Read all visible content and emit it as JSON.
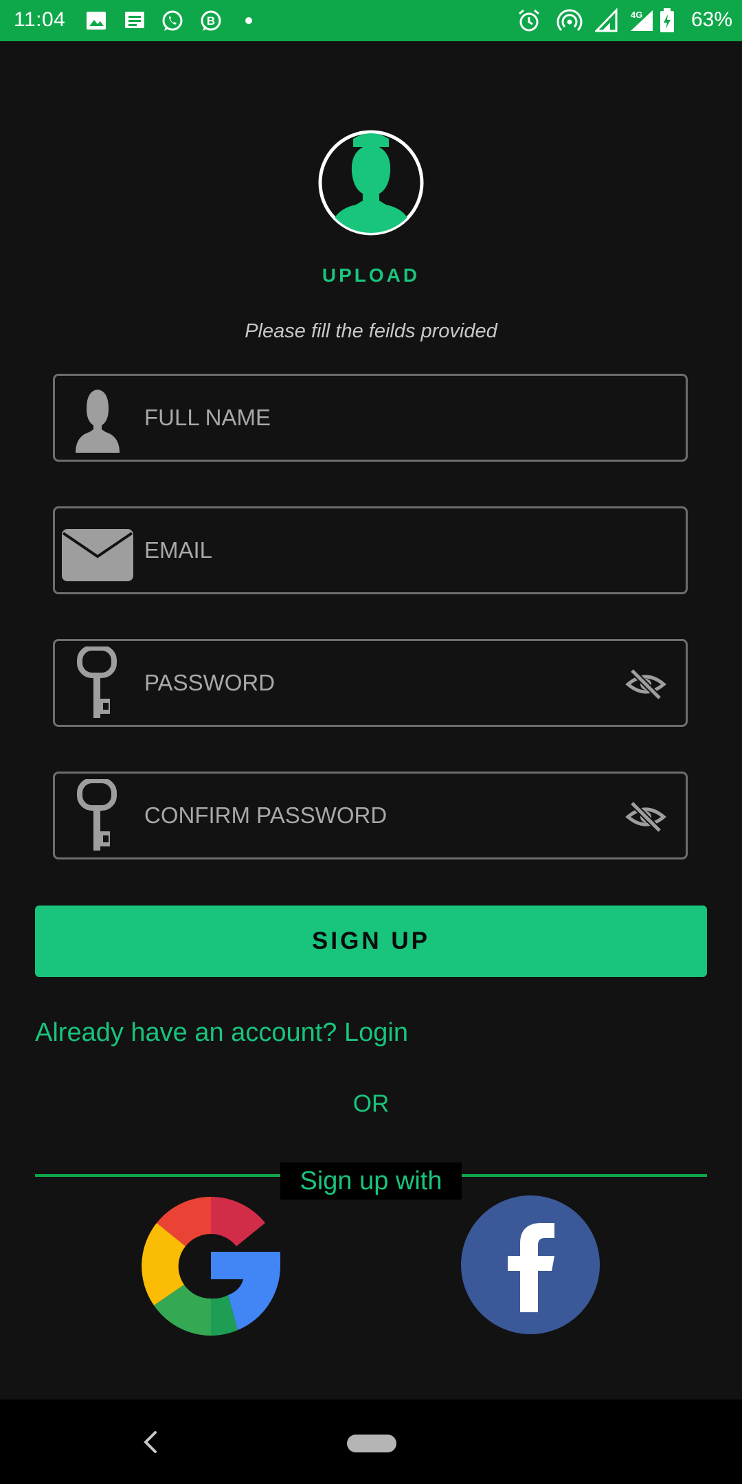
{
  "status_bar": {
    "time": "11:04",
    "battery": "63%",
    "network": "4G",
    "icons_left": [
      "image-icon",
      "message-icon",
      "whatsapp-icon",
      "whatsapp-business-icon",
      "dot-icon"
    ],
    "icons_right": [
      "alarm-icon",
      "hotspot-icon",
      "signal-icon",
      "signal-4g-icon",
      "battery-charging-icon"
    ]
  },
  "profile": {
    "upload_label": "UPLOAD",
    "instruction": "Please fill the feilds provided"
  },
  "form": {
    "full_name_placeholder": "FULL NAME",
    "email_placeholder": "EMAIL",
    "password_placeholder": "PASSWORD",
    "confirm_password_placeholder": "CONFIRM PASSWORD",
    "signup_label": "SIGN UP"
  },
  "footer": {
    "login_link": "Already have an account? Login",
    "or_text": "OR",
    "signup_with": "Sign up with"
  },
  "colors": {
    "accent": "#19c47c",
    "status_bar": "#0ea84a",
    "background": "#121212",
    "field_border": "#6e6e6e",
    "placeholder": "#a8a8a8",
    "facebook": "#3b5998"
  }
}
